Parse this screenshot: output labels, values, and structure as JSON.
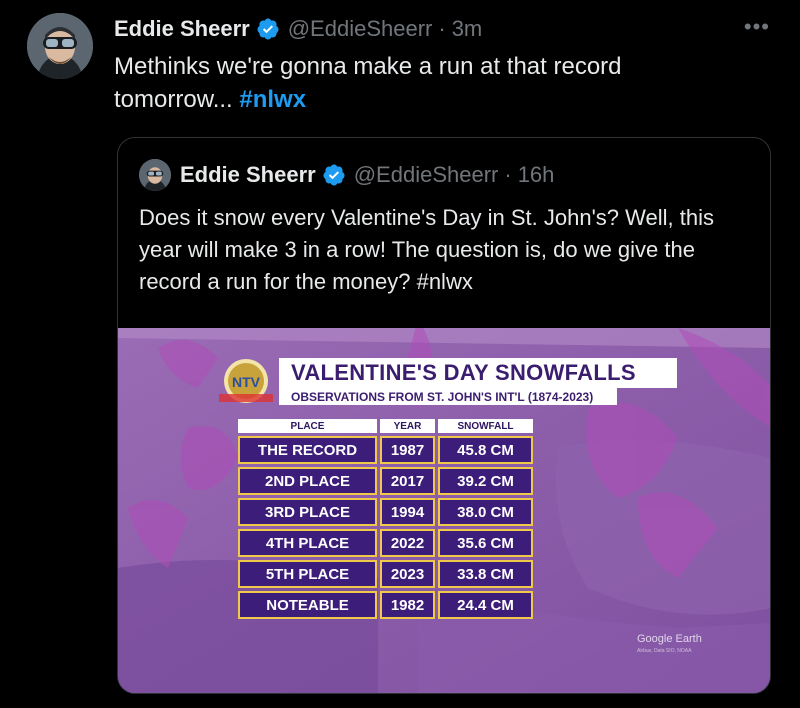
{
  "tweet": {
    "author": {
      "name": "Eddie Sheerr",
      "handle": "@EddieSheerr",
      "time": "3m"
    },
    "text": "Methinks we're gonna make a run at that record tomorrow... ",
    "hashtag": "#nlwx",
    "more_icon": "more-icon"
  },
  "quoted": {
    "author": {
      "name": "Eddie Sheerr",
      "handle": "@EddieSheerr",
      "time": "16h"
    },
    "text": "Does it snow every Valentine's Day in St. John's? Well, this year will make 3 in a row! The question is, do we give the record a run for the money? #nlwx",
    "image": {
      "title": "VALENTINE'S DAY SNOWFALLS",
      "subtitle": "OBSERVATIONS FROM ST. JOHN'S INT'L (1874-2023)",
      "logo_text": "NTV",
      "columns": [
        "PLACE",
        "YEAR",
        "SNOWFALL"
      ],
      "rows": [
        [
          "THE RECORD",
          "1987",
          "45.8 CM"
        ],
        [
          "2ND PLACE",
          "2017",
          "39.2 CM"
        ],
        [
          "3RD PLACE",
          "1994",
          "38.0 CM"
        ],
        [
          "4TH PLACE",
          "2022",
          "35.6 CM"
        ],
        [
          "5TH PLACE",
          "2023",
          "33.8 CM"
        ],
        [
          "NOTEABLE",
          "1982",
          "24.4 CM"
        ]
      ],
      "watermark": "Google Earth",
      "watermark_credit": "Airbus, Data SIO, NOAA"
    }
  },
  "colors": {
    "background": "#000000",
    "text": "#e7e9ea",
    "muted": "#71767b",
    "link": "#1d9bf0",
    "verified": "#1d9bf0",
    "table_cell": "#3d1d7a",
    "table_border": "#f0c94a"
  }
}
